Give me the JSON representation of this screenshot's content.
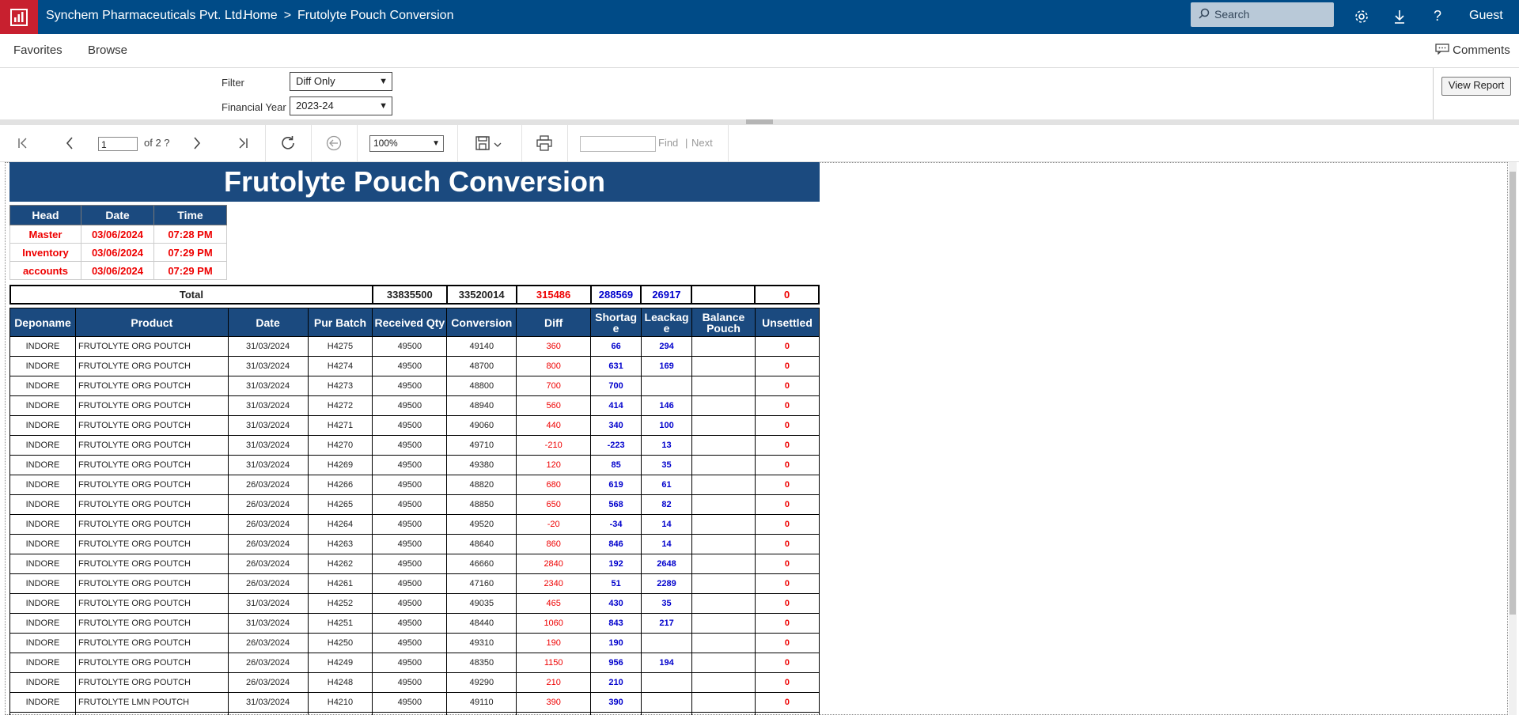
{
  "header": {
    "brand": "Synchem Pharmaceuticals Pvt. Ltd.",
    "breadcrumb_home": "Home",
    "breadcrumb_sep": ">",
    "breadcrumb_current": "Frutolyte Pouch Conversion",
    "search_placeholder": "Search",
    "user": "Guest",
    "icons": [
      "logo-icon",
      "search-icon",
      "gear-icon",
      "download-icon",
      "help-icon"
    ],
    "colors": {
      "bar": "#004b87",
      "logo": "#c8202f"
    }
  },
  "nav": {
    "favorites": "Favorites",
    "browse": "Browse",
    "comments": "Comments"
  },
  "params": {
    "filter_label": "Filter",
    "filter_value": "Diff Only",
    "fy_label": "Financial Year",
    "fy_value": "2023-24",
    "view_report": "View Report"
  },
  "toolbar": {
    "page": "1",
    "of_pages": "of 2 ?",
    "zoom": "100%",
    "find": "Find",
    "sep": "|",
    "next": "Next"
  },
  "report": {
    "title": "Frutolyte Pouch Conversion",
    "meta_headers": [
      "Head",
      "Date",
      "Time"
    ],
    "meta_rows": [
      {
        "head": "Master",
        "date": "03/06/2024",
        "time": "07:28 PM"
      },
      {
        "head": "Inventory",
        "date": "03/06/2024",
        "time": "07:29 PM"
      },
      {
        "head": "accounts",
        "date": "03/06/2024",
        "time": "07:29 PM"
      }
    ],
    "total": {
      "label": "Total",
      "received": "33835500",
      "conversion": "33520014",
      "diff": "315486",
      "shortage": "288569",
      "leakage": "26917",
      "balance": "",
      "unsettled": "0"
    },
    "columns": {
      "depo": "Deponame",
      "product": "Product",
      "date": "Date",
      "batch": "Pur Batch",
      "received": "Received Qty",
      "conversion": "Conversion",
      "diff": "Diff",
      "shortage": "Shortag e",
      "leakage": "Leackag e",
      "balance": "Balance Pouch",
      "unsettled": "Unsettled"
    },
    "rows": [
      {
        "depo": "INDORE",
        "product": "FRUTOLYTE ORG POUTCH",
        "date": "31/03/2024",
        "batch": "H4275",
        "received": "49500",
        "conversion": "49140",
        "diff": "360",
        "shortage": "66",
        "leakage": "294",
        "balance": "",
        "unsettled": "0"
      },
      {
        "depo": "INDORE",
        "product": "FRUTOLYTE ORG POUTCH",
        "date": "31/03/2024",
        "batch": "H4274",
        "received": "49500",
        "conversion": "48700",
        "diff": "800",
        "shortage": "631",
        "leakage": "169",
        "balance": "",
        "unsettled": "0"
      },
      {
        "depo": "INDORE",
        "product": "FRUTOLYTE ORG POUTCH",
        "date": "31/03/2024",
        "batch": "H4273",
        "received": "49500",
        "conversion": "48800",
        "diff": "700",
        "shortage": "700",
        "leakage": "",
        "balance": "",
        "unsettled": "0"
      },
      {
        "depo": "INDORE",
        "product": "FRUTOLYTE ORG POUTCH",
        "date": "31/03/2024",
        "batch": "H4272",
        "received": "49500",
        "conversion": "48940",
        "diff": "560",
        "shortage": "414",
        "leakage": "146",
        "balance": "",
        "unsettled": "0"
      },
      {
        "depo": "INDORE",
        "product": "FRUTOLYTE ORG POUTCH",
        "date": "31/03/2024",
        "batch": "H4271",
        "received": "49500",
        "conversion": "49060",
        "diff": "440",
        "shortage": "340",
        "leakage": "100",
        "balance": "",
        "unsettled": "0"
      },
      {
        "depo": "INDORE",
        "product": "FRUTOLYTE ORG POUTCH",
        "date": "31/03/2024",
        "batch": "H4270",
        "received": "49500",
        "conversion": "49710",
        "diff": "-210",
        "shortage": "-223",
        "leakage": "13",
        "balance": "",
        "unsettled": "0"
      },
      {
        "depo": "INDORE",
        "product": "FRUTOLYTE ORG POUTCH",
        "date": "31/03/2024",
        "batch": "H4269",
        "received": "49500",
        "conversion": "49380",
        "diff": "120",
        "shortage": "85",
        "leakage": "35",
        "balance": "",
        "unsettled": "0"
      },
      {
        "depo": "INDORE",
        "product": "FRUTOLYTE ORG POUTCH",
        "date": "26/03/2024",
        "batch": "H4266",
        "received": "49500",
        "conversion": "48820",
        "diff": "680",
        "shortage": "619",
        "leakage": "61",
        "balance": "",
        "unsettled": "0"
      },
      {
        "depo": "INDORE",
        "product": "FRUTOLYTE ORG POUTCH",
        "date": "26/03/2024",
        "batch": "H4265",
        "received": "49500",
        "conversion": "48850",
        "diff": "650",
        "shortage": "568",
        "leakage": "82",
        "balance": "",
        "unsettled": "0"
      },
      {
        "depo": "INDORE",
        "product": "FRUTOLYTE ORG POUTCH",
        "date": "26/03/2024",
        "batch": "H4264",
        "received": "49500",
        "conversion": "49520",
        "diff": "-20",
        "shortage": "-34",
        "leakage": "14",
        "balance": "",
        "unsettled": "0"
      },
      {
        "depo": "INDORE",
        "product": "FRUTOLYTE ORG POUTCH",
        "date": "26/03/2024",
        "batch": "H4263",
        "received": "49500",
        "conversion": "48640",
        "diff": "860",
        "shortage": "846",
        "leakage": "14",
        "balance": "",
        "unsettled": "0"
      },
      {
        "depo": "INDORE",
        "product": "FRUTOLYTE ORG POUTCH",
        "date": "26/03/2024",
        "batch": "H4262",
        "received": "49500",
        "conversion": "46660",
        "diff": "2840",
        "shortage": "192",
        "leakage": "2648",
        "balance": "",
        "unsettled": "0"
      },
      {
        "depo": "INDORE",
        "product": "FRUTOLYTE ORG POUTCH",
        "date": "26/03/2024",
        "batch": "H4261",
        "received": "49500",
        "conversion": "47160",
        "diff": "2340",
        "shortage": "51",
        "leakage": "2289",
        "balance": "",
        "unsettled": "0"
      },
      {
        "depo": "INDORE",
        "product": "FRUTOLYTE ORG POUTCH",
        "date": "31/03/2024",
        "batch": "H4252",
        "received": "49500",
        "conversion": "49035",
        "diff": "465",
        "shortage": "430",
        "leakage": "35",
        "balance": "",
        "unsettled": "0"
      },
      {
        "depo": "INDORE",
        "product": "FRUTOLYTE ORG POUTCH",
        "date": "31/03/2024",
        "batch": "H4251",
        "received": "49500",
        "conversion": "48440",
        "diff": "1060",
        "shortage": "843",
        "leakage": "217",
        "balance": "",
        "unsettled": "0"
      },
      {
        "depo": "INDORE",
        "product": "FRUTOLYTE ORG POUTCH",
        "date": "26/03/2024",
        "batch": "H4250",
        "received": "49500",
        "conversion": "49310",
        "diff": "190",
        "shortage": "190",
        "leakage": "",
        "balance": "",
        "unsettled": "0"
      },
      {
        "depo": "INDORE",
        "product": "FRUTOLYTE ORG POUTCH",
        "date": "26/03/2024",
        "batch": "H4249",
        "received": "49500",
        "conversion": "48350",
        "diff": "1150",
        "shortage": "956",
        "leakage": "194",
        "balance": "",
        "unsettled": "0"
      },
      {
        "depo": "INDORE",
        "product": "FRUTOLYTE ORG POUTCH",
        "date": "26/03/2024",
        "batch": "H4248",
        "received": "49500",
        "conversion": "49290",
        "diff": "210",
        "shortage": "210",
        "leakage": "",
        "balance": "",
        "unsettled": "0"
      },
      {
        "depo": "INDORE",
        "product": "FRUTOLYTE LMN POUTCH",
        "date": "31/03/2024",
        "batch": "H4210",
        "received": "49500",
        "conversion": "49110",
        "diff": "390",
        "shortage": "390",
        "leakage": "",
        "balance": "",
        "unsettled": "0"
      },
      {
        "depo": "",
        "product": "",
        "date": "",
        "batch": "",
        "received": "",
        "conversion": "",
        "diff": "",
        "shortage": "",
        "leakage": "",
        "balance": "",
        "unsettled": ""
      }
    ]
  }
}
